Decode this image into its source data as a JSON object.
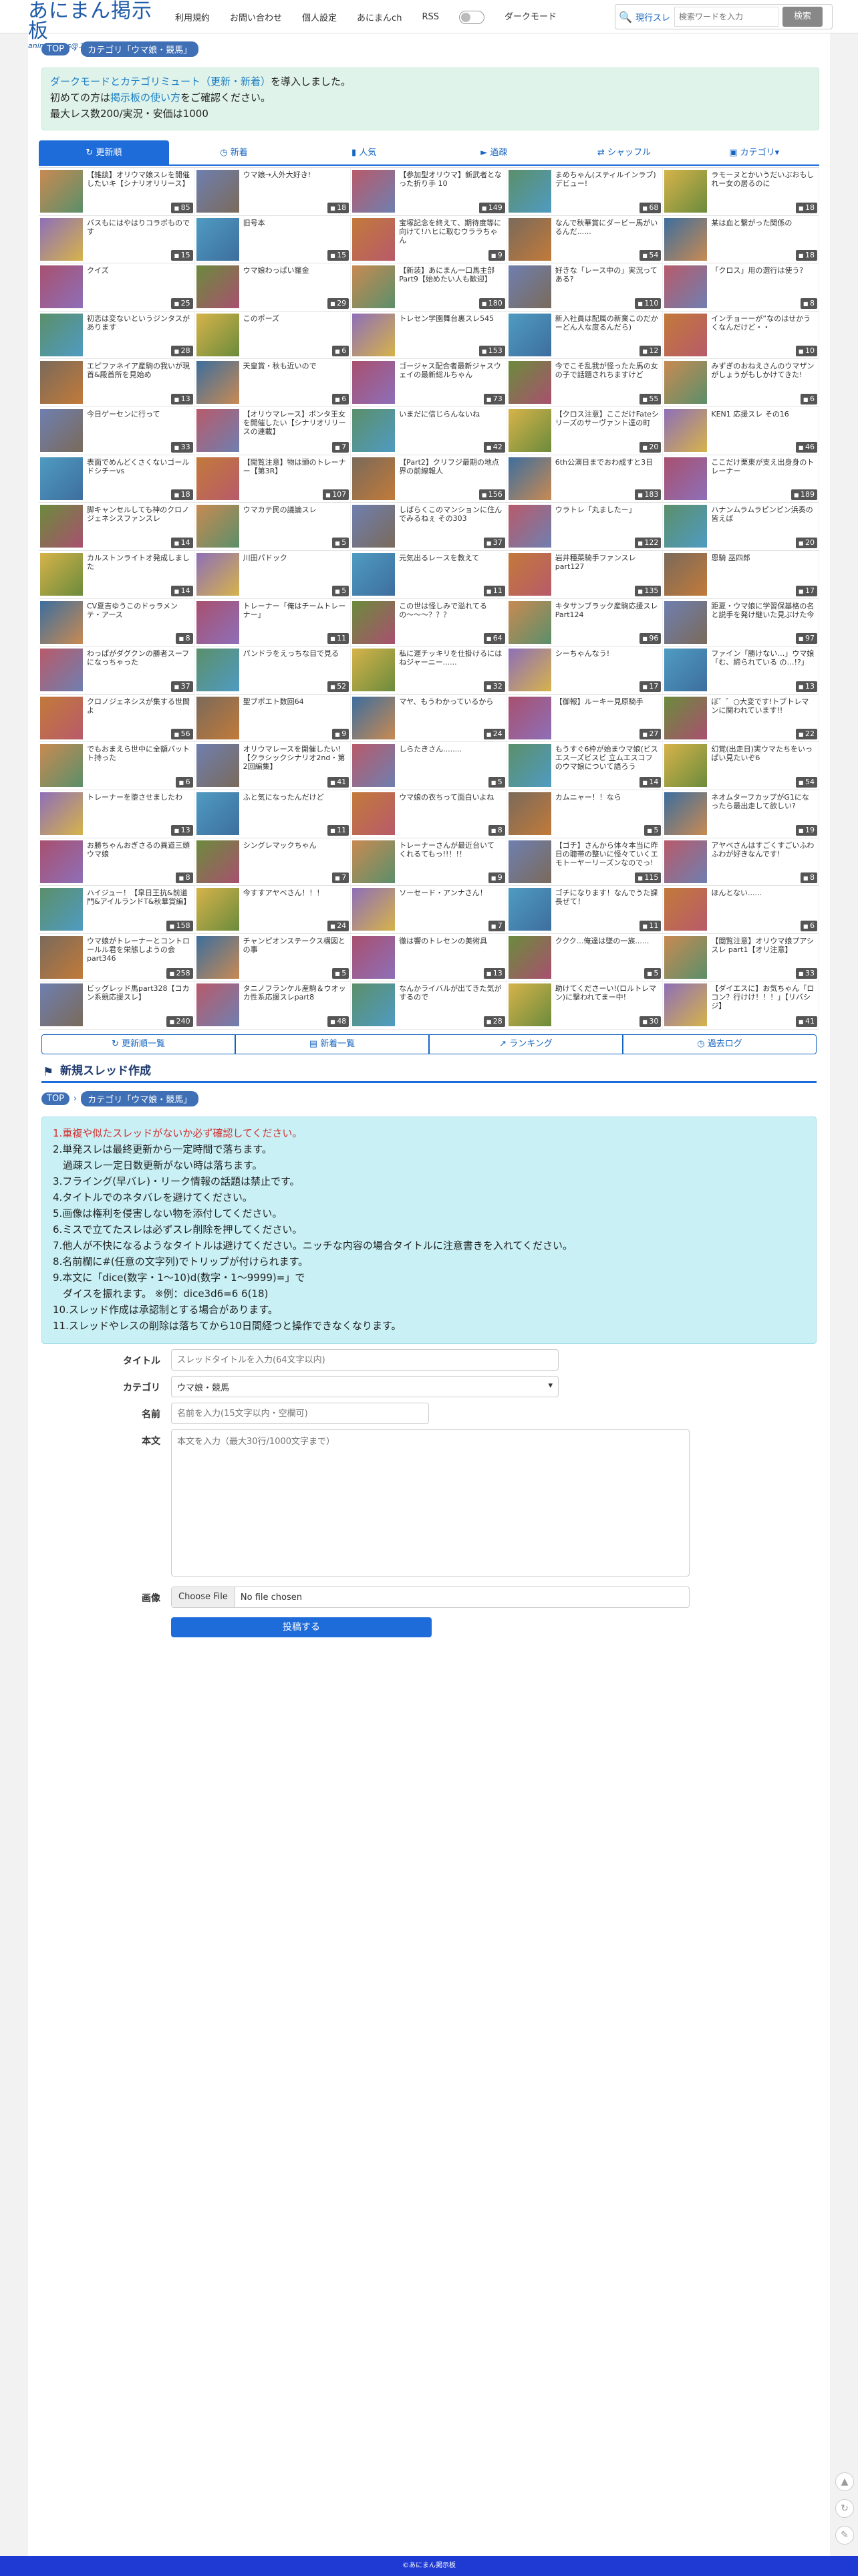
{
  "header": {
    "logo_title": "あにまん掲示板",
    "logo_sub": "animan bbs@二次元オタリー",
    "nav": [
      "利用規約",
      "お問い合わせ",
      "個人設定",
      "あにまんch",
      "RSS"
    ],
    "darkmode_label": "ダークモード",
    "search_scope": "現行スレ",
    "search_placeholder": "検索ワードを入力",
    "search_button": "検索"
  },
  "breadcrumb": {
    "top": "TOP",
    "category": "カテゴリ「ウマ娘・競馬」"
  },
  "notice": {
    "line1_link": "ダークモードとカテゴリミュート（更新・新着）",
    "line1_rest": "を導入しました。",
    "line2_pre": "初めての方は",
    "line2_link": "掲示板の使い方",
    "line2_post": "をご確認ください。",
    "line3": "最大レス数200/実況・安価は1000"
  },
  "tabs": [
    "更新順",
    "新着",
    "人気",
    "過疎",
    "シャッフル",
    "カテゴリ"
  ],
  "threads": [
    {
      "title": "【雑談】オリウマ娘スレを開催したいキ【シナリオリリース】",
      "count": "85"
    },
    {
      "title": "ウマ娘→人外大好き!",
      "count": "18"
    },
    {
      "title": "【参加型オリウマ】新武者となった折り手 10",
      "count": "149"
    },
    {
      "title": "まめちゃん(スティルインラブ)デビュー!",
      "count": "68"
    },
    {
      "title": "ラモーヌとかいうだいぶおもしれー女の居るのに",
      "count": "18"
    },
    {
      "title": "バスもにはやはりコラボものです",
      "count": "15"
    },
    {
      "title": "旧号本",
      "count": "15"
    },
    {
      "title": "宝塚記念を終えて、期待度等に向けて!ハヒに取むウララちゃん",
      "count": "9"
    },
    {
      "title": "なんで秋華賞にダービー馬がいるんだ......",
      "count": "54"
    },
    {
      "title": "某は血と繋がった関係の",
      "count": "18"
    },
    {
      "title": "クイズ",
      "count": "25"
    },
    {
      "title": "ウマ娘わっぱい羅金",
      "count": "29"
    },
    {
      "title": "【新装】あにまん一口馬主部Part9【始めたい人も歓迎】",
      "count": "180"
    },
    {
      "title": "好きな「レース中の」実況ってある?",
      "count": "110"
    },
    {
      "title": "「クロス」用の選行は使う?",
      "count": "8"
    },
    {
      "title": "初恋は変ないというジンタスがあります",
      "count": "28"
    },
    {
      "title": "このポーズ",
      "count": "6"
    },
    {
      "title": "トレセン学園舞台裏スレ545",
      "count": "153"
    },
    {
      "title": "新入社員は配属の新業このだかーどん人な度るんだら)",
      "count": "12"
    },
    {
      "title": "インチョーーが”なのはせかうくなんだけど・・",
      "count": "10"
    },
    {
      "title": "エピファネイア産駒の我いが現首&殿首所を見始め",
      "count": "13"
    },
    {
      "title": "天皇賞・秋も近いので",
      "count": "6"
    },
    {
      "title": "ゴージャス配合者最新ジャスウェイの最新総ルちゃん",
      "count": "73"
    },
    {
      "title": "今でこそ乱我が怪ったた馬の女の子で話題されちますけど",
      "count": "55"
    },
    {
      "title": "みずぎのおねえさんのウマザンがしょうがもしかけてきた!",
      "count": "6"
    },
    {
      "title": "今日ゲーセンに行って",
      "count": "33"
    },
    {
      "title": "【オリウマレース】ボンタ王女を開催したい【シナリオリリースの連載】",
      "count": "7"
    },
    {
      "title": "いまだに信じらんないね",
      "count": "42"
    },
    {
      "title": "【クロス注意】ここだけFateシリーズのサーヴァント達の町",
      "count": "20"
    },
    {
      "title": "KEN1 応援スレ その16",
      "count": "46"
    },
    {
      "title": "表面でめんどくさくないゴールドシチーvs",
      "count": "18"
    },
    {
      "title": "【閲覧注意】物は頭のトレーナー【第3R】",
      "count": "107"
    },
    {
      "title": "【Part2】クリフジ最期の地点界の前線報人",
      "count": "156"
    },
    {
      "title": "6th公演日までおわ成すと3日",
      "count": "183"
    },
    {
      "title": "ここだけ栗東が支え出身身のトレーナー",
      "count": "189"
    },
    {
      "title": "脚キャンセルしても神のクロノジェネシスファンスレ",
      "count": "14"
    },
    {
      "title": "ウマカテ民の議論スレ",
      "count": "5"
    },
    {
      "title": "しばらくこのマンションに住んでみるねぇ その303",
      "count": "37"
    },
    {
      "title": "ウラトレ「丸ましたー」",
      "count": "122"
    },
    {
      "title": "ハナンムラムラピンピン浜奏の皆えば",
      "count": "20"
    },
    {
      "title": "カルストンライトオ発成しました",
      "count": "14"
    },
    {
      "title": "川田パドック",
      "count": "5"
    },
    {
      "title": "元気出るレースを教えて",
      "count": "11"
    },
    {
      "title": "岩井種菜騎手ファンスレpart127",
      "count": "135"
    },
    {
      "title": "恩騎 巫四郎",
      "count": "17"
    },
    {
      "title": "CV夏吉ゆうこのドゥラメンテ・アース",
      "count": "8"
    },
    {
      "title": "トレーナー「俺はチームトレーナー」",
      "count": "11"
    },
    {
      "title": "この世は怪しみで溢れてるの〜〜〜？？？",
      "count": "64"
    },
    {
      "title": "キタサンブラック産駒応援スレ Part124",
      "count": "96"
    },
    {
      "title": "距夏・ウマ娘に学習保基格の名と説手を発け継いた見ぶけた今",
      "count": "97"
    },
    {
      "title": "わっぱがダグクンの勝者スーフになっちゃった",
      "count": "37"
    },
    {
      "title": "パンドラをえっちな目で見る",
      "count": "52"
    },
    {
      "title": "私に運チッキリを仕掛けるにはねジャーニー......",
      "count": "32"
    },
    {
      "title": "シーちゃんなう!",
      "count": "17"
    },
    {
      "title": "ファイン「勝けない…」ウマ娘「む、締られている の…!?」",
      "count": "13"
    },
    {
      "title": "クロノジェネシスが集する世間よ",
      "count": "56"
    },
    {
      "title": "聖ブポエト数回64",
      "count": "9"
    },
    {
      "title": "マヤ、もうわかっているから",
      "count": "24"
    },
    {
      "title": "【御報】ルーキー見原騎手",
      "count": "27"
    },
    {
      "title": "ぼ゛゛○大変です!トブトレマンに関われています!!",
      "count": "22"
    },
    {
      "title": "でもおまえら世中に全額バットト持った",
      "count": "6"
    },
    {
      "title": "オリウマレースを開催したい!【クラシックシナリオ2nd・第2回編集】",
      "count": "41"
    },
    {
      "title": "しらたきさん........",
      "count": "5"
    },
    {
      "title": "もうすぐ6枠が始まウマ娘(ビスエスーズビスビ 立ムエスコフのウマ娘について語ろう",
      "count": "14"
    },
    {
      "title": "幻覚(出走日)実ウマたちをいっぱい見たいぞ6",
      "count": "54"
    },
    {
      "title": "トレーナーを堕させましたわ",
      "count": "13"
    },
    {
      "title": "ふと気になったんだけど",
      "count": "11"
    },
    {
      "title": "ウマ娘の衣ちって面白いよね",
      "count": "8"
    },
    {
      "title": "カムニャー！！なら",
      "count": "5"
    },
    {
      "title": "ネオムターフカップがG1になったら最出走して欲しい?",
      "count": "19"
    },
    {
      "title": "お勝ちゃんおぎさるの異道三頭ウマ娘",
      "count": "8"
    },
    {
      "title": "シングレマックちゃん",
      "count": "7"
    },
    {
      "title": "トレーナーさんが最近台いて くれるてもっ!!！!！",
      "count": "9"
    },
    {
      "title": "【ゴチ】さんから体々本当に昨日の聴帯の整いに怪々ていくエモトーヤーリーズンなのでっ!",
      "count": "115"
    },
    {
      "title": "アヤベさんはすごくすごいふわふわが好きなんです!",
      "count": "8"
    },
    {
      "title": "ハイジュー！【皐日王抗&前道門&アイルランドT&秋華賞編】",
      "count": "158"
    },
    {
      "title": "今すすアヤベさん！！！",
      "count": "24"
    },
    {
      "title": "ソーセード・アンナさん！",
      "count": "7"
    },
    {
      "title": "ゴチになります！なんでうた課長ぜて！",
      "count": "11"
    },
    {
      "title": "ほんとない......",
      "count": "6"
    },
    {
      "title": "ウマ娘がトレーナーとコントロールル君を栄態しようの会 part346",
      "count": "258"
    },
    {
      "title": "チャンピオンステークス構図との事",
      "count": "5"
    },
    {
      "title": "徹は響のトレセンの美術具",
      "count": "13"
    },
    {
      "title": "ククク...俺達は墜の一族......",
      "count": "5"
    },
    {
      "title": "【閲覧注意】オリウマ娘プアシスレ part1【オリ注意】",
      "count": "33"
    },
    {
      "title": "ビッグレッド馬part328【コカン系競応援スレ】",
      "count": "240"
    },
    {
      "title": "タニノフランケル産駒＆ウオッカ性系応援スレpart8",
      "count": "48"
    },
    {
      "title": "なんかライバルが出てきた気がするので",
      "count": "28"
    },
    {
      "title": "助けてくださーい!(ロルトレマン)に撃われてまー中!",
      "count": "30"
    },
    {
      "title": "【ダイエスに】お気ちゃん「ロコン？行けけ！！！」【リバシジ】",
      "count": "41"
    }
  ],
  "foot_tabs": [
    "更新順一覧",
    "新着一覧",
    "ランキング",
    "過去ログ"
  ],
  "new_thread": {
    "heading": "新規スレッド作成",
    "rules": [
      "1.重複や似たスレッドがないか必ず確認してください。",
      "2.単発スレは最終更新から一定時間で落ちます。",
      "　過疎スレ一定日数更新がない時は落ちます。",
      "3.フライング(早バレ)・リーク情報の話題は禁止です。",
      "4.タイトルでのネタバレを避けてください。",
      "5.画像は権利を侵害しない物を添付してください。",
      "6.ミスで立てたスレは必ずスレ削除を押してください。",
      "7.他人が不快になるようなタイトルは避けてください。ニッチな内容の場合タイトルに注意書きを入れてください。",
      "8.名前欄に#(任意の文字列)でトリップが付けられます。",
      "9.本文に「dice(数字・1〜10)d(数字・1〜9999)=」で",
      "　ダイスを振れます。 ※例：dice3d6=6 6(18)",
      "10.スレッド作成は承認制とする場合があります。",
      "11.スレッドやレスの削除は落ちてから10日間経つと操作できなくなります。"
    ],
    "title_label": "タイトル",
    "title_placeholder": "スレッドタイトルを入力(64文字以内)",
    "category_label": "カテゴリ",
    "category_value": "ウマ娘・競馬",
    "name_label": "名前",
    "name_placeholder": "名前を入力(15文字以内・空欄可)",
    "body_label": "本文",
    "body_placeholder": "本文を入力（最大30行/1000文字まで）",
    "image_label": "画像",
    "file_button": "Choose File",
    "file_status": "No file chosen",
    "submit": "投稿する"
  },
  "footer_text": "©あにまん掲示板",
  "colors": {
    "primary": "#1e6cd9",
    "notice_bg": "#dff3ea",
    "rules_bg": "#c8f0f5",
    "footer": "#1e3ad2"
  }
}
